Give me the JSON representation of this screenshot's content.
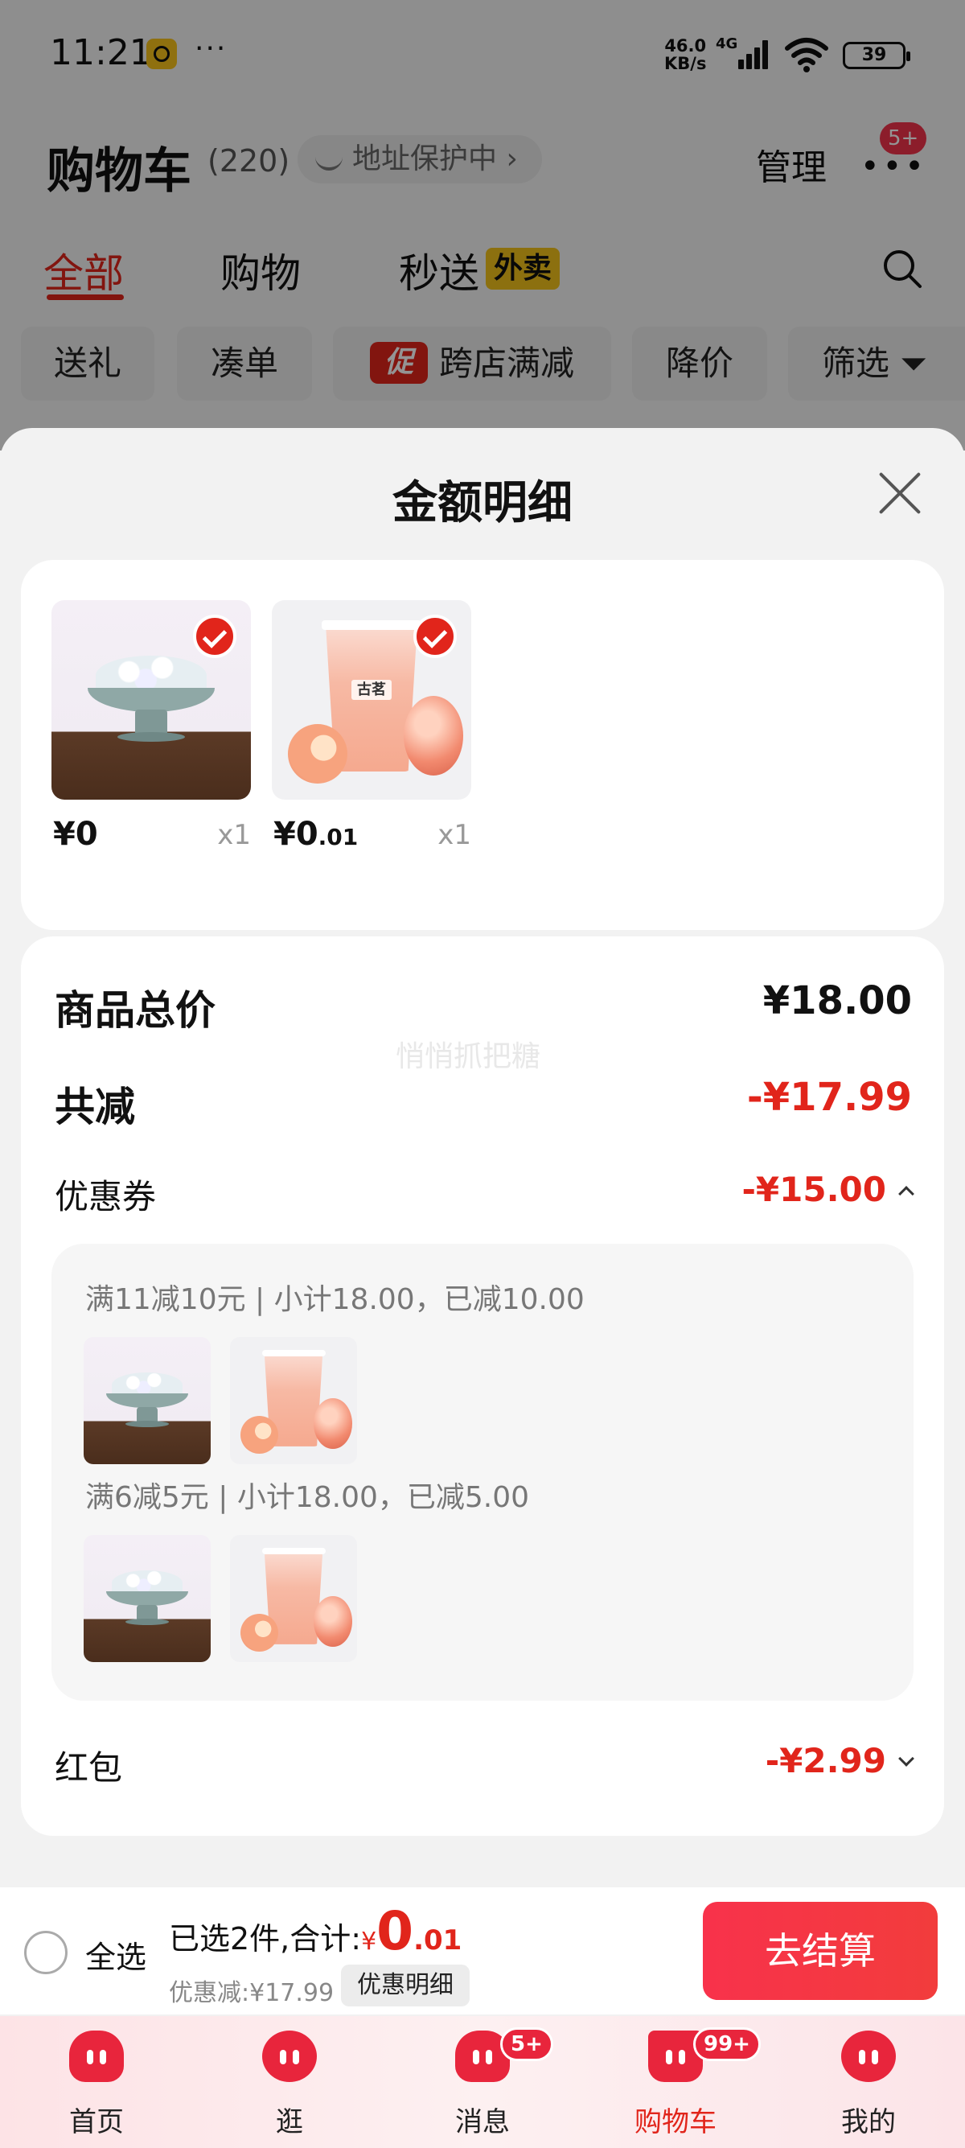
{
  "status_bar": {
    "time": "11:21",
    "more": "···",
    "net_speed": "46.0",
    "net_unit": "KB/s",
    "network_type": "4G",
    "battery": "39"
  },
  "header": {
    "title": "购物车",
    "count": "(220)",
    "address_protection": "地址保护中 ›",
    "manage": "管理",
    "more_badge": "5+"
  },
  "tabs": [
    {
      "label": "全部",
      "active": true
    },
    {
      "label": "购物"
    },
    {
      "label": "秒送",
      "tag": "外卖"
    }
  ],
  "filters": [
    "送礼",
    "凑单",
    "跨店满减",
    "降价",
    "筛选"
  ],
  "filters_promo_tag": "促",
  "sheet": {
    "title": "金额明细",
    "items": [
      {
        "price_main": "¥0",
        "price_decimal": "",
        "qty": "x1",
        "image": "dessert-image"
      },
      {
        "price_main": "¥0",
        "price_decimal": ".01",
        "qty": "x1",
        "image": "peach-tea-image",
        "logo": "古茗"
      }
    ],
    "summary": {
      "total_label": "商品总价",
      "total_value": "¥18.00",
      "reduce_label": "共减",
      "reduce_value": "-¥17.99",
      "coupon_label": "优惠券",
      "coupon_value": "-¥15.00",
      "watermark": "悄悄抓把糖",
      "coupon_rules": [
        {
          "text": "满11减10元 | 小计18.00，已减10.00"
        },
        {
          "text": "满6减5元 | 小计18.00，已减5.00"
        }
      ],
      "redpacket_label": "红包",
      "redpacket_value": "-¥2.99"
    }
  },
  "checkout": {
    "select_all": "全选",
    "selected_text": "已选2件,合计:",
    "currency": "¥",
    "total_int": "0",
    "total_dec": ".01",
    "discount": "优惠减:¥17.99",
    "detail_button": "优惠明细",
    "checkout_button": "去结算"
  },
  "bottom_nav": [
    {
      "label": "首页"
    },
    {
      "label": "逛"
    },
    {
      "label": "消息",
      "badge": "5+"
    },
    {
      "label": "购物车",
      "badge": "99+",
      "active": true
    },
    {
      "label": "我的"
    }
  ],
  "colors": {
    "accent": "#e1251b",
    "checkout_button": "#f8324b",
    "waimai_tag": "#f2c21b"
  }
}
